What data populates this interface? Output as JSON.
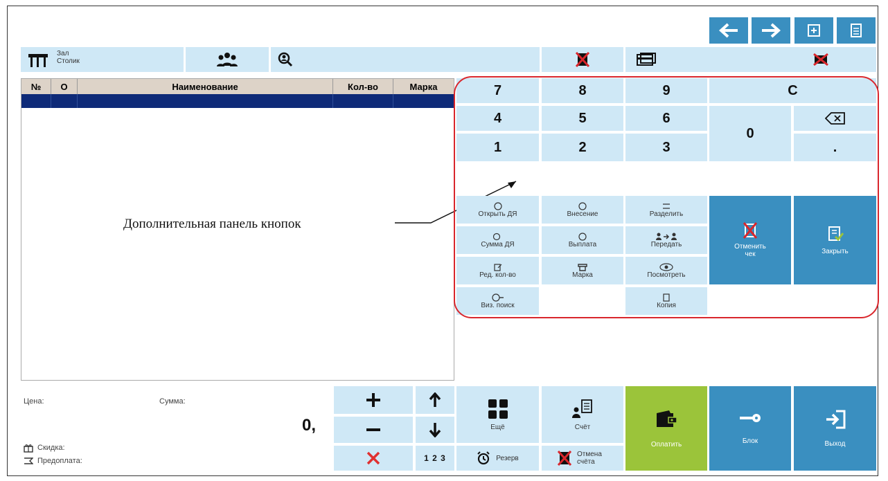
{
  "colors": {
    "light": "#cfe8f6",
    "dark": "#3a8fc0",
    "green": "#9bc43a",
    "header_bg": "#ddd3c8",
    "selected_row": "#0e2a78",
    "annotation": "#d9262c"
  },
  "top_nav": {
    "back_icon": "arrow-left-icon",
    "forward_icon": "arrow-right-icon",
    "add_icon": "plus-square-icon",
    "doc_icon": "document-icon"
  },
  "toolbar": {
    "hall_label": "Зал",
    "table_label": "Столик"
  },
  "table": {
    "headers": [
      "№",
      "О",
      "Наименование",
      "Кол-во",
      "Марка"
    ]
  },
  "keypad": {
    "k7": "7",
    "k8": "8",
    "k9": "9",
    "clear": "C",
    "k4": "4",
    "k5": "5",
    "k6": "6",
    "k0": "0",
    "k1": "1",
    "k2": "2",
    "k3": "3",
    "dot": "."
  },
  "extra": {
    "open_dr": "Открыть ДЯ",
    "deposit": "Внесение",
    "split": "Разделить",
    "sum_dr": "Сумма ДЯ",
    "payout": "Выплата",
    "transfer": "Передать",
    "edit_qty": "Ред. кол-во",
    "mark": "Марка",
    "view": "Посмотреть",
    "vis_search": "Виз. поиск",
    "copy": "Копия",
    "cancel_check": "Отменить чек",
    "close": "Закрыть"
  },
  "annotation": "Дополнительная панель кнопок",
  "bottom": {
    "price_label": "Цена:",
    "sum_label": "Сумма:",
    "amount": "0,",
    "discount_label": "Скидка:",
    "prepay_label": "Предоплата:",
    "more": "Ещё",
    "reserve": "Резерв",
    "bill": "Счёт",
    "cancel_bill": "Отмена счёта",
    "pay": "Оплатить",
    "block": "Блок",
    "exit": "Выход",
    "digits": "1 2 3"
  }
}
